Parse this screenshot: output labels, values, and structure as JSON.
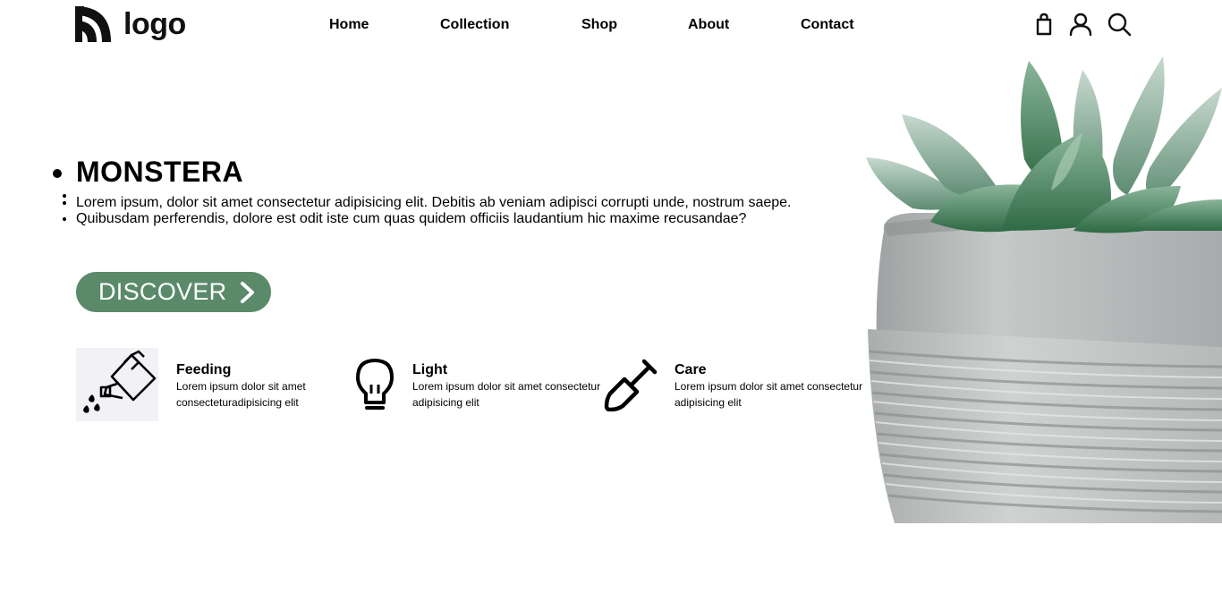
{
  "header": {
    "logo_text": "logo",
    "nav": [
      {
        "label": "Home"
      },
      {
        "label": "Collection"
      },
      {
        "label": "Shop"
      },
      {
        "label": "About"
      },
      {
        "label": "Contact"
      }
    ],
    "icons": [
      "shopping-bag-icon",
      "user-icon",
      "search-icon"
    ]
  },
  "hero": {
    "title": "MONSTERA",
    "lines": [
      "Lorem ipsum, dolor sit amet consectetur adipisicing elit. Debitis ab veniam adipisci corrupti unde, nostrum saepe.",
      "Quibusdam perferendis, dolore est odit iste cum quas quidem officiis laudantium hic maxime recusandae?"
    ],
    "cta_label": "DISCOVER",
    "cta_icon": "chevron-right-icon",
    "image": "succulent-in-concrete-pot"
  },
  "features": [
    {
      "title": "Feeding",
      "description": "Lorem ipsum dolor sit amet consecteturadipisicing elit",
      "icon": "watering-can-icon"
    },
    {
      "title": "Light",
      "description": "Lorem ipsum dolor sit amet consectetur adipisicing elit",
      "icon": "light-bulb-icon"
    },
    {
      "title": "Care",
      "description": "Lorem ipsum dolor sit amet consectetur adipisicing elit",
      "icon": "shovel-icon"
    }
  ],
  "colors": {
    "accent": "#5a8a6a",
    "text": "#000000",
    "background": "#ffffff",
    "icon_tile": "#f2f2f6"
  }
}
